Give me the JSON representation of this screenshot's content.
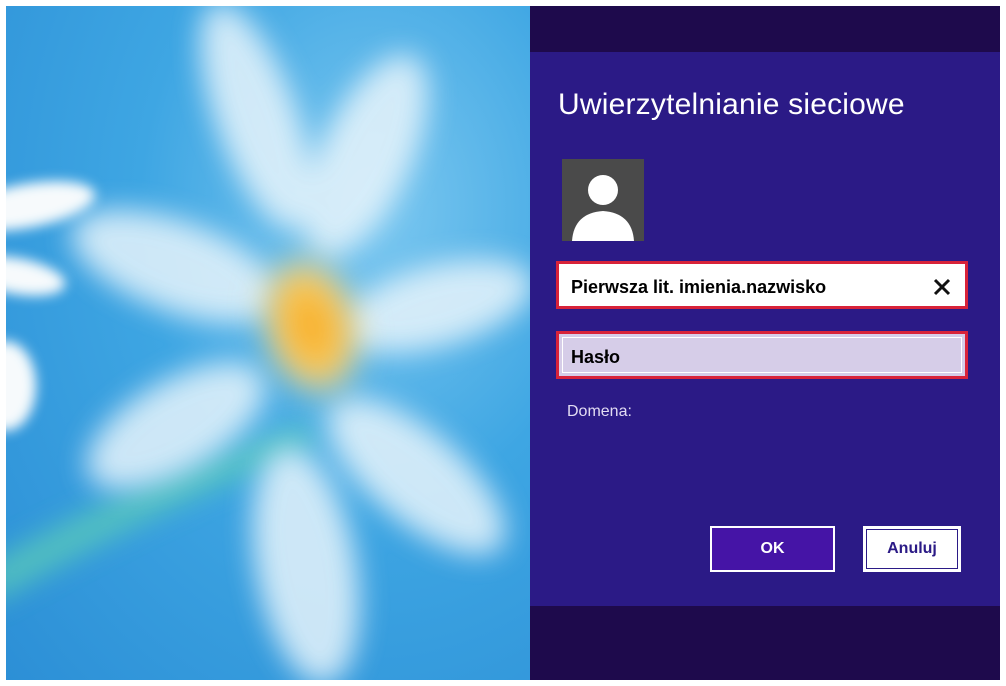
{
  "wallpaper": {
    "description_icon": "daisy-flower-wallpaper"
  },
  "dialog": {
    "title": "Uwierzytelnianie sieciowe",
    "avatar_icon": "user-silhouette-icon",
    "username": {
      "value": "Pierwsza lit. imienia.nazwisko",
      "clear_icon": "close-icon"
    },
    "password": {
      "placeholder": "Hasło"
    },
    "domain_label": "Domena:",
    "ok_label": "OK",
    "cancel_label": "Anuluj"
  },
  "colors": {
    "panel_background": "#2b1a86",
    "panel_bands": "#1e0a4c",
    "highlight_border": "#d8233a",
    "ok_button": "#4514a6",
    "wallpaper_sky": "#3ea6e3"
  }
}
